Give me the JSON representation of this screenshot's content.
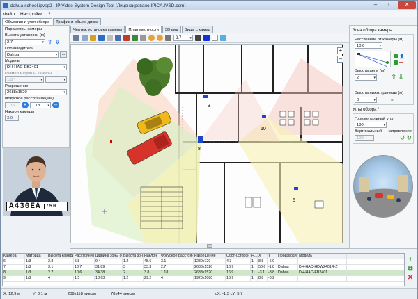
{
  "window": {
    "title": "dahua-school.ipvsp2 - IP Video System Design Tool (Лицензировано IPICA.IVSD.com)"
  },
  "menu": [
    "Файл",
    "Настройки",
    "?"
  ],
  "left_tabs": [
    "Объектив и угол обзора",
    "Трафик и объем диска"
  ],
  "view_tabs": [
    "Чертеж установки камеры",
    "План местности",
    "3D вид",
    "Виды с камер"
  ],
  "left": {
    "section_title": "Параметры камеры",
    "height_label": "Высота установки (м)",
    "height_value": "2.7",
    "vendor_label": "Производитель",
    "vendor_value": "Dahua",
    "model_label": "Модель",
    "model_value": "DH-HAC-EB2401",
    "matrix_label": "Размер матрицы камеры",
    "matrix_value": "1/3 \"",
    "resolution_label": "Разрешение",
    "resolution_value": "2688x1520",
    "focal_label": "Фокусное расстояние(мм)",
    "focal_min": "1.16",
    "focal_value": "1.18",
    "tilt_label": "Наклон камеры",
    "tilt_value": "3.9",
    "plate_text": "A430EA",
    "plate_region": "750"
  },
  "toolbar": {
    "line_width": "2.7"
  },
  "right": {
    "zone_title": "Зона обзора камеры",
    "distance_label": "Расстояние от камеры (м)",
    "distance_value": "10.6",
    "target_height_label": "Высота цели (м)",
    "target_height_value": "2",
    "lower_border_label": "Высота нижн. границы (м)",
    "lower_border_value": "0",
    "angles_title": "Углы обзора °",
    "horizontal_label": "Горизонтальный угол",
    "horizontal_value": "180",
    "vertical_label": "Вертикальный",
    "vertical_value": "100",
    "direction_label": "Направление"
  },
  "map": {
    "labels": [
      "3",
      "10",
      "5",
      "8"
    ]
  },
  "table": {
    "headers": [
      "Камера",
      "Матрица",
      "Высота камеры",
      "Расстояние",
      "Ширина зоны обзора",
      "Высота зон...",
      "Наклон",
      "Фокусное расстояние",
      "Разрешение",
      "Соотн.сторон",
      "H...",
      "X",
      "Y",
      "Производитель",
      "Модель"
    ],
    "rows": [
      [
        "6",
        "1/3",
        "2.8",
        "5.8",
        "9.4",
        "1.2",
        "45.6",
        "3.1",
        "1280x720",
        "4:3",
        "1",
        "8.8",
        "-5.9",
        "",
        ""
      ],
      [
        "7",
        "1/3",
        "3.1",
        "13.7",
        "31.89",
        "3",
        "33.3",
        "2.7",
        "2688x1520",
        "16:9",
        "1",
        "50.6",
        "-1.8",
        "Dahua",
        "DH-HAC-HDW2401R-Z"
      ],
      [
        "8",
        "1/3",
        "2.7",
        "10.6",
        "34.38",
        "2",
        "3.8",
        "1.18",
        "2688x1520",
        "16:9",
        "1",
        "-3.1",
        "-8.8",
        "Dahua",
        "DH-HAC-EB2401"
      ],
      [
        "9",
        "1/3",
        "4",
        "1.5",
        "18.63",
        "1.2",
        "29.2",
        "4",
        "1920x1080",
        "16:9",
        "1",
        "8.8",
        "-6.2",
        "",
        ""
      ]
    ]
  },
  "status": {
    "x": "X: 12.9 м",
    "y": "Y: 3.1 м",
    "pix1": "209x118 пикс/м",
    "pix2": "78x44 пикс/м",
    "coords": "cX: -1.3 cY: 5.7"
  }
}
